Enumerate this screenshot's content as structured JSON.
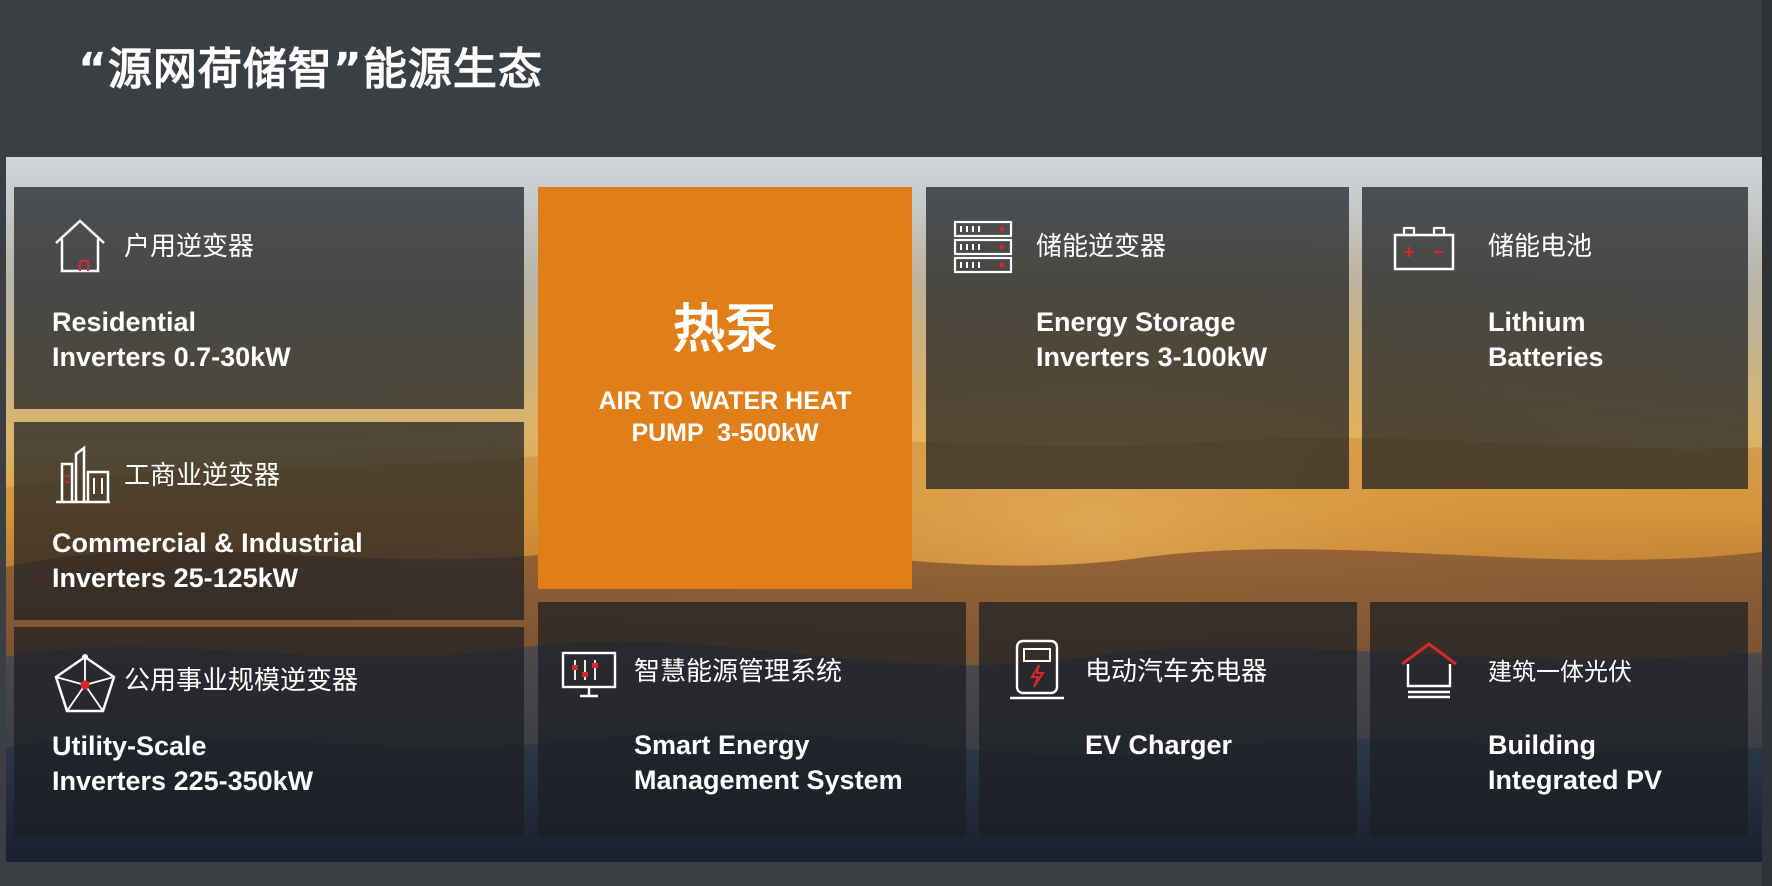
{
  "page": {
    "title": "“源网荷储智”能源生态"
  },
  "tiles": {
    "residential": {
      "label_cn": "户用逆变器",
      "label_en_line1": "Residential",
      "label_en_line2": "Inverters 0.7-30kW",
      "icon": "house-icon"
    },
    "commercial": {
      "label_cn": "工商业逆变器",
      "label_en_line1": "Commercial & Industrial",
      "label_en_line2": "Inverters 25-125kW",
      "icon": "factory-icon"
    },
    "utility": {
      "label_cn": "公用事业规模逆变器",
      "label_en_line1": "Utility-Scale",
      "label_en_line2": "Inverters 225-350kW",
      "icon": "pentagon-network-icon"
    },
    "heat_pump": {
      "label_cn": "热泵",
      "label_en_line1": "AIR TO WATER HEAT",
      "label_en_line2": "PUMP  3-500kW"
    },
    "energy_storage": {
      "label_cn": "储能逆变器",
      "label_en_line1": "Energy Storage",
      "label_en_line2": "Inverters 3-100kW",
      "icon": "storage-rack-icon"
    },
    "battery": {
      "label_cn": "储能电池",
      "label_en_line1": "Lithium",
      "label_en_line2": "Batteries",
      "icon": "battery-icon"
    },
    "sems": {
      "label_cn": "智慧能源管理系统",
      "label_en_line1": "Smart Energy",
      "label_en_line2": "Management System",
      "icon": "monitor-sliders-icon"
    },
    "ev_charger": {
      "label_cn": "电动汽车充电器",
      "label_en_line1": "EV Charger",
      "icon": "ev-charger-icon"
    },
    "bipv": {
      "label_cn": "建筑一体光伏",
      "label_en_line1": "Building",
      "label_en_line2": "Integrated PV",
      "icon": "roof-house-icon"
    }
  },
  "colors": {
    "background": "#3b3f44",
    "accent_orange": "#e07f1a",
    "icon_red": "#d9262b",
    "icon_white": "#ffffff"
  }
}
